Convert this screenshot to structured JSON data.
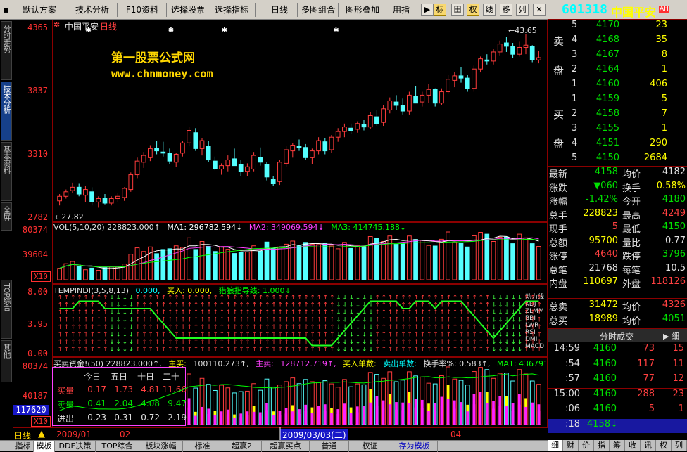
{
  "toolbar": {
    "items": [
      "默认方案",
      "技术分析",
      "F10资料",
      "选择股票",
      "选择指标",
      "日线",
      "多图组合",
      "图形叠加",
      "用指"
    ],
    "icons": [
      "标",
      "田",
      "权",
      "线",
      "移",
      "列"
    ]
  },
  "left_tabs": [
    "分时走势",
    "技术分析",
    "基本资料",
    "全屏",
    "TOP综合",
    "其他"
  ],
  "main": {
    "stock_title": "中国平安",
    "period": "日线",
    "watermark_title": "第一股票公式网",
    "watermark_url": "www.chnmoney.com",
    "price_axis": [
      "4365",
      "3837",
      "3310",
      "2782"
    ],
    "low_label": "←27.82",
    "high_label": "←43.65"
  },
  "vol_pane": {
    "header": [
      {
        "text": "VOL(5,10,20) 228823.000↑",
        "color": "#e0e0e0"
      },
      {
        "text": "MA1: 296782.594↓",
        "color": "#ffffff"
      },
      {
        "text": "MA2: 349069.594↓",
        "color": "#ff40ff"
      },
      {
        "text": "MA3: 414745.188↓",
        "color": "#00ff00"
      }
    ],
    "axis": [
      "80374",
      "39604"
    ],
    "scale": "X10"
  },
  "ind_pane": {
    "header": [
      {
        "text": "TEMPINDI(3,5,8,13)",
        "color": "#e0e0e0"
      },
      {
        "text": "0.000,",
        "color": "#00ffff"
      },
      {
        "text": "买入: 0.000,",
        "color": "#ffff00"
      },
      {
        "text": "猎狼指导线: 1.000↓",
        "color": "#00ff00"
      }
    ],
    "axis": [
      "8.00",
      "3.95",
      "0.00"
    ],
    "side_labels": [
      "动力线",
      "KDJ",
      "ZLMM",
      "BBI",
      "LWR",
      "RSI",
      "DMI",
      "MACD"
    ]
  },
  "fund_pane": {
    "header": [
      {
        "text": "买卖资金!(50) 228823.000↑,",
        "color": "#e0e0e0"
      },
      {
        "text": "主买:",
        "color": "#ffff00"
      },
      {
        "text": "100110.273↑,",
        "color": "#e0e0e0"
      },
      {
        "text": "主卖:",
        "color": "#ff40ff"
      },
      {
        "text": "128712.719↑,",
        "color": "#ff40ff"
      },
      {
        "text": "买入单数:",
        "color": "#ffff00"
      },
      {
        "text": "卖出单数:",
        "color": "#00ffff"
      },
      {
        "text": "换手率%: 0.583↑,",
        "color": "#e0e0e0"
      },
      {
        "text": "MA1: 436791.000",
        "color": "#00ff00"
      }
    ],
    "axis": [
      "80374",
      "40187"
    ],
    "scale": "X10",
    "cursor_value": "117620",
    "table": {
      "cols": [
        "今日",
        "五日",
        "十日",
        "二十"
      ],
      "rows": [
        {
          "label": "买量",
          "values": [
            "0.17",
            "1.73",
            "4.81",
            "11.66"
          ],
          "color": "#ff4040"
        },
        {
          "label": "卖量",
          "values": [
            "0.41",
            "2.04",
            "4.08",
            "9.47"
          ],
          "color": "#00e000"
        },
        {
          "label": "进出",
          "values": [
            "-0.23",
            "-0.31",
            "0.72",
            "2.19"
          ],
          "color": "#e0e0e0"
        }
      ]
    }
  },
  "time_axis": {
    "labels": [
      "2009/01",
      "02",
      "04"
    ],
    "cursor_date": "2009/03/03(二)",
    "period": "日线"
  },
  "bottom_tabs": [
    "指标",
    "模板",
    "DDE决策",
    "TOP综合",
    "板块涨幅",
    "标准",
    "超赢2",
    "超赢买点",
    "普通",
    "权证",
    "存为模板"
  ],
  "quote": {
    "code": "601318",
    "name": "中国平安",
    "badge": "AH",
    "sell_label": [
      "卖",
      "盘"
    ],
    "buy_label": [
      "买",
      "盘"
    ],
    "sells": [
      {
        "lvl": "5",
        "price": "4170",
        "vol": "23"
      },
      {
        "lvl": "4",
        "price": "4168",
        "vol": "35"
      },
      {
        "lvl": "3",
        "price": "4167",
        "vol": "8"
      },
      {
        "lvl": "2",
        "price": "4164",
        "vol": "1"
      },
      {
        "lvl": "1",
        "price": "4160",
        "vol": "406"
      }
    ],
    "buys": [
      {
        "lvl": "1",
        "price": "4159",
        "vol": "5"
      },
      {
        "lvl": "2",
        "price": "4158",
        "vol": "7"
      },
      {
        "lvl": "3",
        "price": "4155",
        "vol": "1"
      },
      {
        "lvl": "4",
        "price": "4151",
        "vol": "290"
      },
      {
        "lvl": "5",
        "price": "4150",
        "vol": "2684"
      }
    ],
    "stats": [
      [
        "最新",
        "4158",
        "均价",
        "4182"
      ],
      [
        "涨跌",
        "▼060",
        "换手",
        "0.58%"
      ],
      [
        "涨幅",
        "-1.42%",
        "今开",
        "4180"
      ],
      [
        "总手",
        "228823",
        "最高",
        "4249"
      ],
      [
        "现手",
        "5",
        "最低",
        "4150"
      ],
      [
        "总额",
        "95700",
        "量比",
        "0.77"
      ],
      [
        "涨停",
        "4640",
        "跌停",
        "3796"
      ],
      [
        "总笔",
        "21768",
        "每笔",
        "10.5"
      ],
      [
        "内盘",
        "110697",
        "外盘",
        "118126"
      ]
    ],
    "totals": [
      [
        "总卖",
        "31472",
        "均价",
        "4326"
      ],
      [
        "总买",
        "18989",
        "均价",
        "4051"
      ]
    ],
    "ticks_title": "分时成交",
    "ticks": [
      {
        "time": "14:59",
        "price": "4160",
        "vol": "73",
        "num": "15"
      },
      {
        "time": ":54",
        "price": "4160",
        "vol": "117",
        "num": "11"
      },
      {
        "time": ":57",
        "price": "4160",
        "vol": "77",
        "num": "12"
      },
      {
        "time": "15:00",
        "price": "4160",
        "vol": "288",
        "num": "23"
      },
      {
        "time": ":06",
        "price": "4160",
        "vol": "5",
        "num": "1"
      },
      {
        "time": ":18",
        "price": "4158↓",
        "vol": "",
        "num": ""
      }
    ],
    "bottom_tabs": [
      "细",
      "财",
      "价",
      "指",
      "筹",
      "收",
      "讯",
      "权",
      "列"
    ]
  },
  "chart_data": {
    "type": "candlestick",
    "title": "中国平安 日线",
    "ylim": [
      27.5,
      44.2
    ],
    "candles": [
      [
        29.0,
        29.6,
        28.6,
        29.4
      ],
      [
        29.4,
        30.0,
        29.2,
        29.8
      ],
      [
        29.9,
        30.6,
        29.7,
        30.2
      ],
      [
        30.2,
        30.5,
        29.4,
        29.6
      ],
      [
        29.5,
        30.3,
        28.9,
        30.0
      ],
      [
        29.8,
        30.2,
        28.6,
        28.9
      ],
      [
        28.9,
        29.4,
        28.4,
        29.2
      ],
      [
        29.2,
        29.6,
        28.7,
        28.8
      ],
      [
        28.8,
        29.4,
        28.6,
        29.2
      ],
      [
        29.2,
        29.7,
        28.9,
        29.4
      ],
      [
        29.3,
        30.2,
        29.0,
        30.1
      ],
      [
        30.0,
        31.5,
        29.8,
        31.3
      ],
      [
        31.3,
        32.8,
        31.0,
        32.5
      ],
      [
        32.4,
        33.3,
        31.9,
        33.0
      ],
      [
        32.8,
        33.9,
        32.5,
        33.6
      ],
      [
        33.6,
        34.3,
        33.1,
        33.4
      ],
      [
        33.3,
        34.2,
        32.9,
        33.2
      ],
      [
        33.2,
        33.6,
        32.2,
        32.5
      ],
      [
        32.4,
        33.2,
        32.0,
        33.1
      ],
      [
        33.2,
        34.3,
        32.9,
        34.1
      ],
      [
        34.1,
        35.5,
        33.8,
        35.2
      ],
      [
        35.0,
        35.4,
        33.4,
        33.6
      ],
      [
        33.6,
        34.5,
        33.0,
        34.3
      ],
      [
        33.8,
        34.3,
        32.4,
        32.6
      ],
      [
        32.5,
        32.9,
        31.7,
        31.8
      ],
      [
        31.8,
        32.3,
        31.3,
        32.1
      ],
      [
        32.1,
        33.0,
        31.6,
        32.6
      ],
      [
        32.7,
        33.6,
        32.2,
        32.1
      ],
      [
        32.2,
        32.6,
        31.2,
        31.6
      ],
      [
        31.6,
        32.3,
        31.2,
        32.0
      ],
      [
        31.8,
        33.3,
        31.6,
        33.0
      ],
      [
        32.8,
        33.7,
        32.1,
        32.4
      ],
      [
        32.2,
        32.4,
        30.8,
        31.1
      ],
      [
        30.9,
        31.2,
        30.3,
        30.5
      ],
      [
        30.7,
        32.6,
        30.4,
        32.4
      ],
      [
        32.3,
        33.8,
        32.0,
        33.5
      ],
      [
        33.4,
        34.1,
        32.8,
        33.9
      ],
      [
        33.8,
        34.4,
        33.4,
        33.7
      ],
      [
        33.7,
        34.0,
        32.6,
        32.8
      ],
      [
        32.8,
        33.6,
        32.2,
        33.4
      ],
      [
        33.4,
        34.6,
        33.1,
        34.3
      ],
      [
        34.2,
        34.5,
        33.1,
        33.4
      ],
      [
        33.5,
        34.8,
        33.2,
        34.6
      ],
      [
        34.6,
        35.4,
        34.2,
        35.1
      ],
      [
        35.1,
        35.8,
        34.6,
        35.5
      ],
      [
        35.4,
        35.8,
        34.9,
        35.2
      ],
      [
        35.3,
        36.0,
        35.0,
        35.8
      ],
      [
        35.7,
        36.1,
        35.2,
        35.5
      ],
      [
        35.5,
        36.8,
        35.3,
        36.5
      ],
      [
        36.4,
        37.0,
        35.6,
        35.8
      ],
      [
        35.9,
        37.4,
        35.6,
        37.1
      ],
      [
        37.0,
        38.1,
        36.7,
        37.8
      ],
      [
        37.7,
        38.3,
        37.0,
        37.4
      ],
      [
        37.4,
        38.0,
        36.6,
        36.9
      ],
      [
        36.9,
        38.6,
        36.6,
        38.3
      ],
      [
        38.2,
        39.1,
        37.8,
        37.6
      ],
      [
        37.7,
        38.6,
        37.3,
        38.3
      ],
      [
        38.3,
        39.3,
        37.6,
        38.8
      ],
      [
        38.8,
        38.9,
        37.3,
        37.6
      ],
      [
        37.6,
        38.9,
        37.4,
        38.6
      ],
      [
        38.6,
        40.1,
        38.4,
        39.7
      ],
      [
        39.6,
        40.3,
        39.0,
        40.0
      ],
      [
        40.0,
        40.8,
        39.4,
        39.8
      ],
      [
        39.8,
        40.1,
        38.6,
        38.9
      ],
      [
        38.9,
        40.9,
        38.6,
        40.6
      ],
      [
        40.6,
        41.7,
        40.3,
        41.5
      ],
      [
        41.4,
        41.9,
        41.0,
        41.3
      ],
      [
        41.3,
        42.4,
        41.0,
        42.1
      ],
      [
        42.1,
        43.1,
        41.8,
        42.8
      ],
      [
        42.9,
        43.4,
        42.1,
        42.6
      ],
      [
        42.6,
        42.9,
        41.6,
        41.9
      ],
      [
        41.9,
        43.0,
        41.7,
        42.5
      ],
      [
        42.5,
        43.65,
        41.9,
        42.7
      ],
      [
        42.6,
        42.7,
        41.2,
        41.4
      ],
      [
        41.4,
        42.2,
        41.1,
        41.6
      ]
    ],
    "volume": [
      63,
      88,
      100,
      73,
      55,
      64,
      52,
      69,
      70,
      70,
      86,
      140,
      175,
      155,
      180,
      143,
      166,
      170,
      186,
      177,
      230,
      166,
      210,
      183,
      155,
      179,
      167,
      144,
      150,
      152,
      186,
      156,
      207,
      171,
      180,
      195,
      212,
      186,
      205,
      195,
      193,
      200,
      185,
      170,
      205,
      172,
      185,
      181,
      237,
      228,
      210,
      240,
      195,
      202,
      240,
      221,
      216,
      188,
      185,
      222,
      262,
      207,
      201,
      180,
      241,
      260,
      250,
      210,
      233,
      234,
      198,
      250,
      230,
      198,
      183
    ],
    "fund_buy": [
      28,
      30,
      40,
      25,
      32,
      22,
      20,
      30,
      34,
      30,
      40,
      55,
      78,
      88,
      62,
      54,
      72,
      60,
      66,
      70,
      120,
      58,
      80,
      72,
      62,
      60,
      68,
      46,
      50,
      60,
      85,
      56,
      98,
      60,
      62,
      74,
      88,
      70,
      90,
      78,
      84,
      92,
      76,
      70,
      95,
      78,
      82,
      86,
      160,
      130,
      110,
      140,
      102,
      100,
      150,
      118,
      112,
      95,
      98,
      126,
      180,
      110,
      102,
      90,
      140,
      148,
      150,
      108,
      130,
      128,
      96,
      138,
      120,
      100,
      92
    ],
    "fund_sell": [
      20,
      22,
      30,
      18,
      22,
      16,
      14,
      22,
      26,
      20,
      28,
      38,
      52,
      56,
      42,
      36,
      48,
      40,
      44,
      46,
      78,
      40,
      54,
      48,
      42,
      40,
      46,
      32,
      34,
      42,
      58,
      40,
      66,
      42,
      44,
      50,
      60,
      48,
      62,
      52,
      58,
      64,
      52,
      48,
      64,
      52,
      56,
      58,
      100,
      84,
      74,
      92,
      68,
      66,
      98,
      78,
      74,
      62,
      64,
      84,
      116,
      72,
      68,
      60,
      92,
      96,
      98,
      72,
      86,
      84,
      64,
      90,
      80,
      66,
      62
    ],
    "ma_vol": [
      {
        "name": "MA1",
        "color": "#ffffff"
      },
      {
        "name": "MA2",
        "color": "#ff40ff"
      },
      {
        "name": "MA3",
        "color": "#00ff00"
      }
    ],
    "guide_line": [
      6,
      6,
      6,
      7,
      7,
      7,
      7,
      6,
      6,
      6,
      6,
      6,
      6,
      6,
      6,
      5,
      4,
      3,
      2,
      2,
      2,
      2,
      2,
      2,
      2,
      2,
      2,
      2,
      2,
      2,
      2,
      2,
      2,
      2,
      2,
      2,
      2,
      2,
      2,
      1,
      1,
      1,
      1,
      2,
      3,
      4,
      5,
      6,
      7,
      7,
      7,
      7,
      7,
      6,
      6,
      7,
      7,
      7,
      6,
      7,
      7,
      7,
      7,
      6,
      5,
      4,
      3,
      2,
      3,
      4,
      5,
      6,
      7,
      7,
      7
    ],
    "ind_arrows_up": [
      1,
      1,
      1,
      1,
      1,
      1,
      1,
      1,
      0,
      0,
      0,
      0,
      1,
      1,
      1,
      1,
      1,
      1,
      1,
      1,
      1,
      1,
      1,
      1,
      1,
      1,
      1,
      1,
      1,
      1,
      1,
      1,
      1,
      1,
      1,
      1,
      1,
      1,
      1,
      1,
      1,
      1,
      1,
      0,
      0,
      0,
      0,
      0,
      0,
      1,
      1,
      1,
      1,
      1,
      1,
      1,
      1,
      1,
      1,
      1,
      1,
      1,
      1,
      1,
      1,
      1,
      1,
      0,
      0,
      0,
      0,
      0,
      1,
      1,
      1
    ]
  }
}
